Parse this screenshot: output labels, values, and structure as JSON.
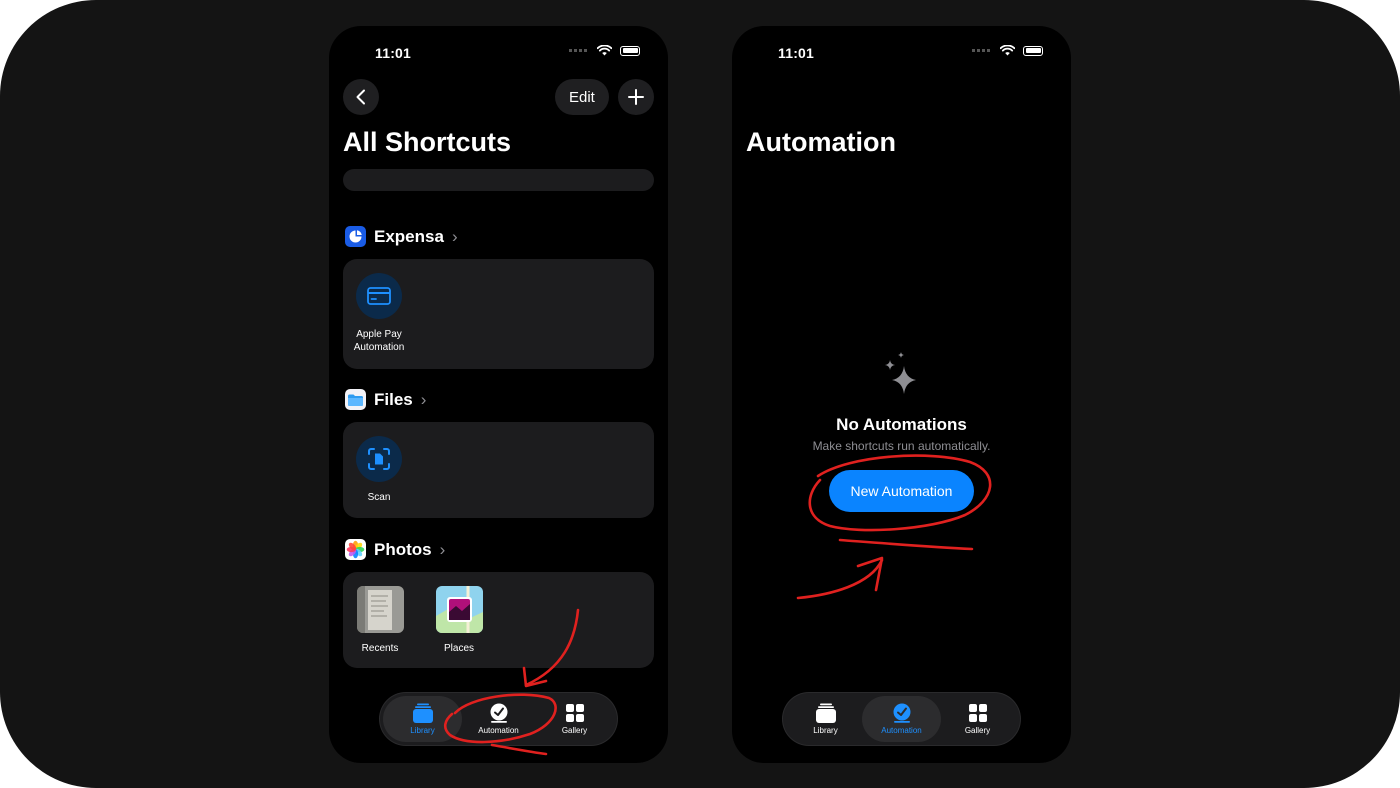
{
  "left": {
    "status": {
      "time": "11:01"
    },
    "nav": {
      "back_icon": "chevron-left-icon",
      "edit_label": "Edit",
      "add_icon": "plus-icon"
    },
    "title": "All Shortcuts",
    "sections": [
      {
        "name": "Expensa",
        "icon": "expensa-app-icon",
        "actions": [
          {
            "label_line1": "Apple Pay",
            "label_line2": "Automation",
            "icon": "credit-card-icon"
          }
        ]
      },
      {
        "name": "Files",
        "icon": "files-app-icon",
        "actions": [
          {
            "label": "Scan",
            "icon": "document-scan-icon"
          }
        ]
      },
      {
        "name": "Photos",
        "icon": "photos-app-icon",
        "actions": [
          {
            "label": "Recents",
            "icon": "recents-thumbnail"
          },
          {
            "label": "Places",
            "icon": "places-thumbnail"
          }
        ]
      }
    ],
    "tabs": [
      {
        "label": "Library",
        "icon": "library-icon",
        "active": true
      },
      {
        "label": "Automation",
        "icon": "clock-check-icon",
        "active": false
      },
      {
        "label": "Gallery",
        "icon": "grid-icon",
        "active": false
      }
    ]
  },
  "right": {
    "status": {
      "time": "11:01"
    },
    "title": "Automation",
    "empty_state": {
      "icon": "sparkles-icon",
      "heading": "No Automations",
      "subtext": "Make shortcuts run automatically.",
      "button_label": "New Automation"
    },
    "tabs": [
      {
        "label": "Library",
        "icon": "library-icon",
        "active": false
      },
      {
        "label": "Automation",
        "icon": "clock-check-icon",
        "active": true
      },
      {
        "label": "Gallery",
        "icon": "grid-icon",
        "active": false
      }
    ]
  },
  "colors": {
    "accent": "#0a84ff",
    "annotation": "#e0211f",
    "card": "#1c1c1e",
    "frame": "#141414"
  }
}
